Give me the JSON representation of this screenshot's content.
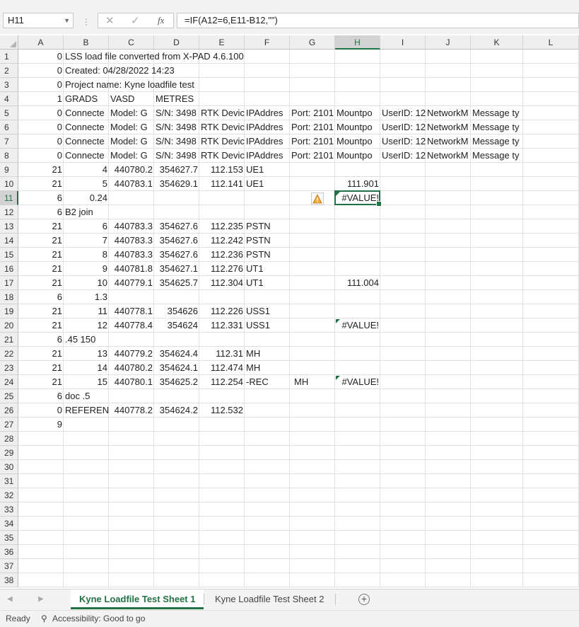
{
  "name_box": "H11",
  "formula": "=IF(A12=6,E11-B12,\"\")",
  "columns": [
    "A",
    "B",
    "C",
    "D",
    "E",
    "F",
    "G",
    "H",
    "I",
    "J",
    "K",
    "L"
  ],
  "selected_column": "H",
  "selected_row": 11,
  "rows_visible": 38,
  "cells": [
    {
      "r": 1,
      "c": "A",
      "v": "0"
    },
    {
      "r": 1,
      "c": "B",
      "v": "LSS load file converted from X-PAD 4.6.100"
    },
    {
      "r": 2,
      "c": "A",
      "v": "0"
    },
    {
      "r": 2,
      "c": "B",
      "v": "Created: 04/28/2022 14:23"
    },
    {
      "r": 3,
      "c": "A",
      "v": "0"
    },
    {
      "r": 3,
      "c": "B",
      "v": "Project name: Kyne loadfile test"
    },
    {
      "r": 4,
      "c": "A",
      "v": "1"
    },
    {
      "r": 4,
      "c": "B",
      "v": "GRADS"
    },
    {
      "r": 4,
      "c": "C",
      "v": "VASD"
    },
    {
      "r": 4,
      "c": "D",
      "v": "METRES"
    },
    {
      "r": 5,
      "c": "A",
      "v": "0"
    },
    {
      "r": 5,
      "c": "B",
      "v": "Connecte"
    },
    {
      "r": 5,
      "c": "C",
      "v": "Model: G"
    },
    {
      "r": 5,
      "c": "D",
      "v": "S/N: 3498"
    },
    {
      "r": 5,
      "c": "E",
      "v": "RTK Devic"
    },
    {
      "r": 5,
      "c": "F",
      "v": "IPAddres"
    },
    {
      "r": 5,
      "c": "G",
      "v": "Port: 2101"
    },
    {
      "r": 5,
      "c": "H",
      "v": "Mountpo"
    },
    {
      "r": 5,
      "c": "I",
      "v": "UserID: 12"
    },
    {
      "r": 5,
      "c": "J",
      "v": "NetworkM"
    },
    {
      "r": 5,
      "c": "K",
      "v": "Message ty"
    },
    {
      "r": 6,
      "c": "A",
      "v": "0"
    },
    {
      "r": 6,
      "c": "B",
      "v": "Connecte"
    },
    {
      "r": 6,
      "c": "C",
      "v": "Model: G"
    },
    {
      "r": 6,
      "c": "D",
      "v": "S/N: 3498"
    },
    {
      "r": 6,
      "c": "E",
      "v": "RTK Devic"
    },
    {
      "r": 6,
      "c": "F",
      "v": "IPAddres"
    },
    {
      "r": 6,
      "c": "G",
      "v": "Port: 2101"
    },
    {
      "r": 6,
      "c": "H",
      "v": "Mountpo"
    },
    {
      "r": 6,
      "c": "I",
      "v": "UserID: 12"
    },
    {
      "r": 6,
      "c": "J",
      "v": "NetworkM"
    },
    {
      "r": 6,
      "c": "K",
      "v": "Message ty"
    },
    {
      "r": 7,
      "c": "A",
      "v": "0"
    },
    {
      "r": 7,
      "c": "B",
      "v": "Connecte"
    },
    {
      "r": 7,
      "c": "C",
      "v": "Model: G"
    },
    {
      "r": 7,
      "c": "D",
      "v": "S/N: 3498"
    },
    {
      "r": 7,
      "c": "E",
      "v": "RTK Devic"
    },
    {
      "r": 7,
      "c": "F",
      "v": "IPAddres"
    },
    {
      "r": 7,
      "c": "G",
      "v": "Port: 2101"
    },
    {
      "r": 7,
      "c": "H",
      "v": "Mountpo"
    },
    {
      "r": 7,
      "c": "I",
      "v": "UserID: 12"
    },
    {
      "r": 7,
      "c": "J",
      "v": "NetworkM"
    },
    {
      "r": 7,
      "c": "K",
      "v": "Message ty"
    },
    {
      "r": 8,
      "c": "A",
      "v": "0"
    },
    {
      "r": 8,
      "c": "B",
      "v": "Connecte"
    },
    {
      "r": 8,
      "c": "C",
      "v": "Model: G"
    },
    {
      "r": 8,
      "c": "D",
      "v": "S/N: 3498"
    },
    {
      "r": 8,
      "c": "E",
      "v": "RTK Devic"
    },
    {
      "r": 8,
      "c": "F",
      "v": "IPAddres"
    },
    {
      "r": 8,
      "c": "G",
      "v": "Port: 2101"
    },
    {
      "r": 8,
      "c": "H",
      "v": "Mountpo"
    },
    {
      "r": 8,
      "c": "I",
      "v": "UserID: 12"
    },
    {
      "r": 8,
      "c": "J",
      "v": "NetworkM"
    },
    {
      "r": 8,
      "c": "K",
      "v": "Message ty"
    },
    {
      "r": 9,
      "c": "A",
      "v": "21"
    },
    {
      "r": 9,
      "c": "B",
      "v": "4",
      "n": 1
    },
    {
      "r": 9,
      "c": "C",
      "v": "440780.2",
      "n": 1
    },
    {
      "r": 9,
      "c": "D",
      "v": "354627.7",
      "n": 1
    },
    {
      "r": 9,
      "c": "E",
      "v": "112.153",
      "n": 1
    },
    {
      "r": 9,
      "c": "F",
      "v": "UE1"
    },
    {
      "r": 10,
      "c": "A",
      "v": "21"
    },
    {
      "r": 10,
      "c": "B",
      "v": "5",
      "n": 1
    },
    {
      "r": 10,
      "c": "C",
      "v": "440783.1",
      "n": 1
    },
    {
      "r": 10,
      "c": "D",
      "v": "354629.1",
      "n": 1
    },
    {
      "r": 10,
      "c": "E",
      "v": "112.141",
      "n": 1
    },
    {
      "r": 10,
      "c": "F",
      "v": "UE1"
    },
    {
      "r": 10,
      "c": "H",
      "v": "111.901",
      "n": 1
    },
    {
      "r": 11,
      "c": "A",
      "v": "6"
    },
    {
      "r": 11,
      "c": "B",
      "v": "0.24",
      "n": 1
    },
    {
      "r": 11,
      "c": "H",
      "v": "#VALUE!",
      "n": 1,
      "tri": 1
    },
    {
      "r": 12,
      "c": "A",
      "v": "6"
    },
    {
      "r": 12,
      "c": "B",
      "v": "B2 join"
    },
    {
      "r": 13,
      "c": "A",
      "v": "21"
    },
    {
      "r": 13,
      "c": "B",
      "v": "6",
      "n": 1
    },
    {
      "r": 13,
      "c": "C",
      "v": "440783.3",
      "n": 1
    },
    {
      "r": 13,
      "c": "D",
      "v": "354627.6",
      "n": 1
    },
    {
      "r": 13,
      "c": "E",
      "v": "112.235",
      "n": 1
    },
    {
      "r": 13,
      "c": "F",
      "v": "PSTN"
    },
    {
      "r": 14,
      "c": "A",
      "v": "21"
    },
    {
      "r": 14,
      "c": "B",
      "v": "7",
      "n": 1
    },
    {
      "r": 14,
      "c": "C",
      "v": "440783.3",
      "n": 1
    },
    {
      "r": 14,
      "c": "D",
      "v": "354627.6",
      "n": 1
    },
    {
      "r": 14,
      "c": "E",
      "v": "112.242",
      "n": 1
    },
    {
      "r": 14,
      "c": "F",
      "v": "PSTN"
    },
    {
      "r": 15,
      "c": "A",
      "v": "21"
    },
    {
      "r": 15,
      "c": "B",
      "v": "8",
      "n": 1
    },
    {
      "r": 15,
      "c": "C",
      "v": "440783.3",
      "n": 1
    },
    {
      "r": 15,
      "c": "D",
      "v": "354627.6",
      "n": 1
    },
    {
      "r": 15,
      "c": "E",
      "v": "112.236",
      "n": 1
    },
    {
      "r": 15,
      "c": "F",
      "v": "PSTN"
    },
    {
      "r": 16,
      "c": "A",
      "v": "21"
    },
    {
      "r": 16,
      "c": "B",
      "v": "9",
      "n": 1
    },
    {
      "r": 16,
      "c": "C",
      "v": "440781.8",
      "n": 1
    },
    {
      "r": 16,
      "c": "D",
      "v": "354627.1",
      "n": 1
    },
    {
      "r": 16,
      "c": "E",
      "v": "112.276",
      "n": 1
    },
    {
      "r": 16,
      "c": "F",
      "v": "UT1"
    },
    {
      "r": 17,
      "c": "A",
      "v": "21"
    },
    {
      "r": 17,
      "c": "B",
      "v": "10",
      "n": 1
    },
    {
      "r": 17,
      "c": "C",
      "v": "440779.1",
      "n": 1
    },
    {
      "r": 17,
      "c": "D",
      "v": "354625.7",
      "n": 1
    },
    {
      "r": 17,
      "c": "E",
      "v": "112.304",
      "n": 1
    },
    {
      "r": 17,
      "c": "F",
      "v": "UT1"
    },
    {
      "r": 17,
      "c": "H",
      "v": "111.004",
      "n": 1
    },
    {
      "r": 18,
      "c": "A",
      "v": "6"
    },
    {
      "r": 18,
      "c": "B",
      "v": "1.3",
      "n": 1
    },
    {
      "r": 19,
      "c": "A",
      "v": "21"
    },
    {
      "r": 19,
      "c": "B",
      "v": "11",
      "n": 1
    },
    {
      "r": 19,
      "c": "C",
      "v": "440778.1",
      "n": 1
    },
    {
      "r": 19,
      "c": "D",
      "v": "354626",
      "n": 1
    },
    {
      "r": 19,
      "c": "E",
      "v": "112.226",
      "n": 1
    },
    {
      "r": 19,
      "c": "F",
      "v": "USS1"
    },
    {
      "r": 20,
      "c": "A",
      "v": "21"
    },
    {
      "r": 20,
      "c": "B",
      "v": "12",
      "n": 1
    },
    {
      "r": 20,
      "c": "C",
      "v": "440778.4",
      "n": 1
    },
    {
      "r": 20,
      "c": "D",
      "v": "354624",
      "n": 1
    },
    {
      "r": 20,
      "c": "E",
      "v": "112.331",
      "n": 1
    },
    {
      "r": 20,
      "c": "F",
      "v": "USS1"
    },
    {
      "r": 20,
      "c": "H",
      "v": "#VALUE!",
      "n": 1,
      "tri": 1
    },
    {
      "r": 21,
      "c": "A",
      "v": "6"
    },
    {
      "r": 21,
      "c": "B",
      "v": ".45 150"
    },
    {
      "r": 22,
      "c": "A",
      "v": "21"
    },
    {
      "r": 22,
      "c": "B",
      "v": "13",
      "n": 1
    },
    {
      "r": 22,
      "c": "C",
      "v": "440779.2",
      "n": 1
    },
    {
      "r": 22,
      "c": "D",
      "v": "354624.4",
      "n": 1
    },
    {
      "r": 22,
      "c": "E",
      "v": "112.31",
      "n": 1
    },
    {
      "r": 22,
      "c": "F",
      "v": "MH"
    },
    {
      "r": 23,
      "c": "A",
      "v": "21"
    },
    {
      "r": 23,
      "c": "B",
      "v": "14",
      "n": 1
    },
    {
      "r": 23,
      "c": "C",
      "v": "440780.2",
      "n": 1
    },
    {
      "r": 23,
      "c": "D",
      "v": "354624.1",
      "n": 1
    },
    {
      "r": 23,
      "c": "E",
      "v": "112.474",
      "n": 1
    },
    {
      "r": 23,
      "c": "F",
      "v": "MH"
    },
    {
      "r": 24,
      "c": "A",
      "v": "21"
    },
    {
      "r": 24,
      "c": "B",
      "v": "15",
      "n": 1
    },
    {
      "r": 24,
      "c": "C",
      "v": "440780.1",
      "n": 1
    },
    {
      "r": 24,
      "c": "D",
      "v": "354625.2",
      "n": 1
    },
    {
      "r": 24,
      "c": "E",
      "v": "112.254",
      "n": 1
    },
    {
      "r": 24,
      "c": "F",
      "v": "-REC"
    },
    {
      "r": 24,
      "c": "G",
      "v": "MH",
      "ind": 1
    },
    {
      "r": 24,
      "c": "H",
      "v": "#VALUE!",
      "n": 1,
      "tri": 1
    },
    {
      "r": 25,
      "c": "A",
      "v": "6"
    },
    {
      "r": 25,
      "c": "B",
      "v": "doc .5"
    },
    {
      "r": 26,
      "c": "A",
      "v": "0"
    },
    {
      "r": 26,
      "c": "B",
      "v": "REFERENC"
    },
    {
      "r": 26,
      "c": "C",
      "v": "440778.2",
      "n": 1
    },
    {
      "r": 26,
      "c": "D",
      "v": "354624.2",
      "n": 1
    },
    {
      "r": 26,
      "c": "E",
      "v": "112.532",
      "n": 1
    },
    {
      "r": 27,
      "c": "A",
      "v": "9"
    }
  ],
  "sheets": [
    "Kyne Loadfile Test Sheet 1",
    "Kyne Loadfile Test Sheet 2"
  ],
  "active_sheet": 0,
  "status": {
    "ready": "Ready",
    "accessibility": "Accessibility: Good to go"
  },
  "accent_color": "#217346"
}
